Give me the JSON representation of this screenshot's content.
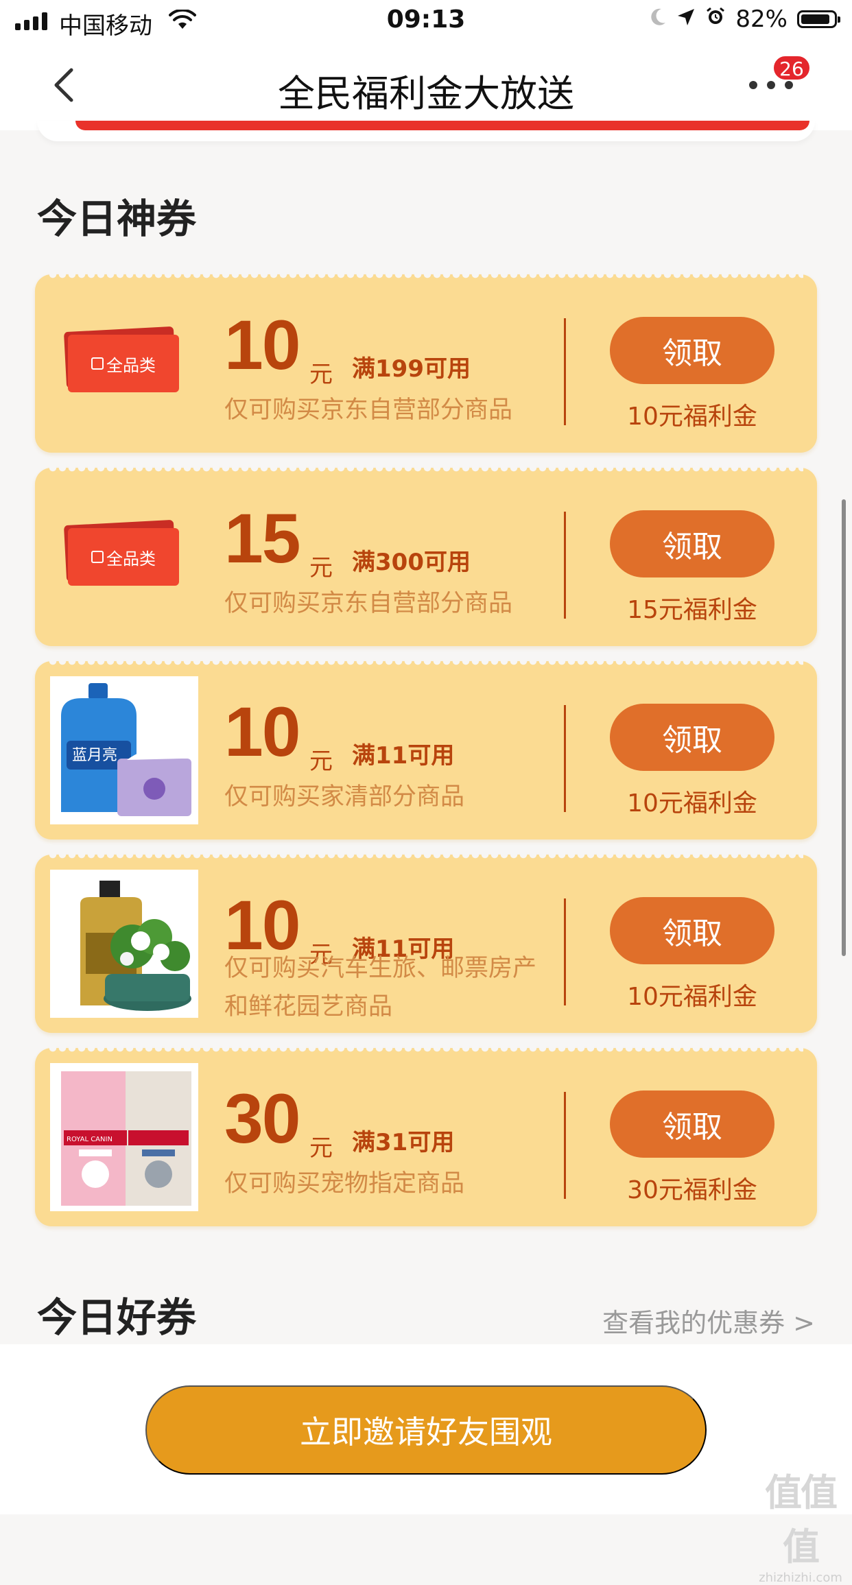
{
  "status_bar": {
    "carrier": "中国移动",
    "time": "09:13",
    "battery": "82%"
  },
  "nav": {
    "title": "全民福利金大放送",
    "badge_count": "26"
  },
  "sections": {
    "today_title": "今日神券",
    "good_title": "今日好券",
    "view_my_coupons": "查看我的优惠券 >"
  },
  "coupons": [
    {
      "image": "ticket-tag-icon",
      "image_label": "全品类",
      "amount": "10",
      "unit": "元",
      "condition": "满199可用",
      "desc": "仅可购买京东自营部分商品",
      "button": "领取",
      "reward": "10元福利金"
    },
    {
      "image": "ticket-tag-icon",
      "image_label": "全品类",
      "amount": "15",
      "unit": "元",
      "condition": "满300可用",
      "desc": "仅可购买京东自营部分商品",
      "button": "领取",
      "reward": "15元福利金"
    },
    {
      "image": "detergent-tissue-photo",
      "image_label": "蓝月亮",
      "amount": "10",
      "unit": "元",
      "condition": "满11可用",
      "desc": "仅可购买家清部分商品",
      "button": "领取",
      "reward": "10元福利金"
    },
    {
      "image": "motor-oil-flower-photo",
      "amount": "10",
      "unit": "元",
      "condition": "满11可用",
      "desc_line1": "仅可购买汽车生旅、邮票房产",
      "desc_line2": "和鲜花园艺商品",
      "button": "领取",
      "reward": "10元福利金"
    },
    {
      "image": "pet-food-bags-photo",
      "image_label": "ROYAL CANIN",
      "amount": "30",
      "unit": "元",
      "condition": "满31可用",
      "desc": "仅可购买宠物指定商品",
      "button": "领取",
      "reward": "30元福利金"
    }
  ],
  "bottom": {
    "invite_button": "立即邀请好友围观"
  },
  "watermark": {
    "big": "值值值",
    "small": "zhizhizhi.com"
  },
  "colors": {
    "card_bg": "#fbdb92",
    "accent_text": "#b8440d",
    "button": "#e06f2a",
    "invite_button": "#e69a1c",
    "badge": "#e4262c"
  }
}
